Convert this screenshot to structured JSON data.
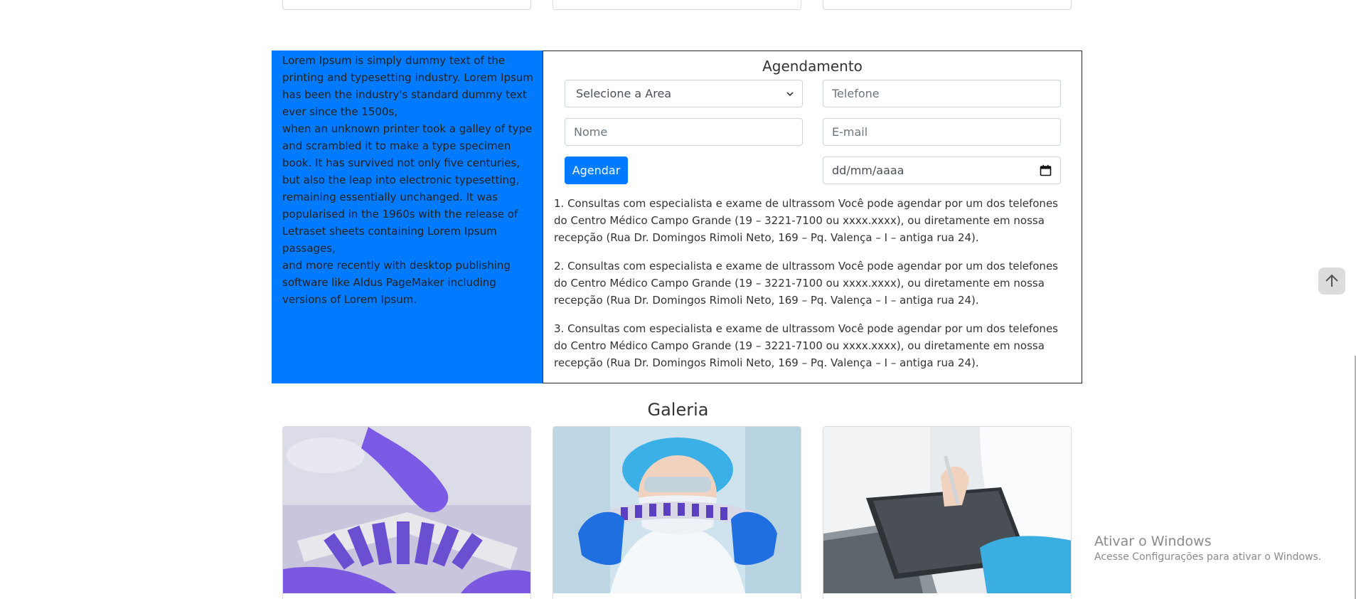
{
  "intro_text": [
    "Lorem Ipsum is simply dummy text of the printing and typesetting industry. Lorem Ipsum has been the industry's standard dummy text ever since the 1500s,",
    "when an unknown printer took a galley of type and scrambled it to make a type specimen book. It has survived not only five centuries, but also the leap into electronic typesetting, remaining essentially unchanged. It was popularised in the 1960s with the release of Letraset sheets containing Lorem Ipsum passages,",
    "and more recently with desktop publishing software like Aldus PageMaker including versions of Lorem Ipsum."
  ],
  "booking": {
    "title": "Agendamento",
    "area_select": "Selecione a Area",
    "phone_placeholder": "Telefone",
    "name_placeholder": "Nome",
    "email_placeholder": "E-mail",
    "submit_label": "Agendar",
    "date_placeholder": "dd/mm/aaaa"
  },
  "info_items": [
    "1. Consultas com especialista e exame de ultrassom Você pode agendar por um dos telefones do Centro Médico Campo Grande (19 – 3221-7100 ou xxxx.xxxx), ou diretamente em nossa recepção (Rua Dr. Domingos Rimoli Neto, 169 – Pq. Valença – I – antiga rua 24).",
    "2. Consultas com especialista e exame de ultrassom Você pode agendar por um dos telefones do Centro Médico Campo Grande (19 – 3221-7100 ou xxxx.xxxx), ou diretamente em nossa recepção (Rua Dr. Domingos Rimoli Neto, 169 – Pq. Valença – I – antiga rua 24).",
    "3. Consultas com especialista e exame de ultrassom Você pode agendar por um dos telefones do Centro Médico Campo Grande (19 – 3221-7100 ou xxxx.xxxx), ou diretamente em nossa recepção (Rua Dr. Domingos Rimoli Neto, 169 – Pq. Valença – I – antiga rua 24)."
  ],
  "gallery": {
    "title": "Galeria"
  },
  "watermark": {
    "title": "Ativar o Windows",
    "subtitle": "Acesse Configurações para ativar o Windows."
  },
  "colors": {
    "primary": "#007bff",
    "panel_border": "#212529",
    "field_border": "#ced4da"
  },
  "icons": {
    "select": "chevron-down-icon",
    "date": "calendar-icon",
    "scroll": "arrow-up-icon"
  }
}
